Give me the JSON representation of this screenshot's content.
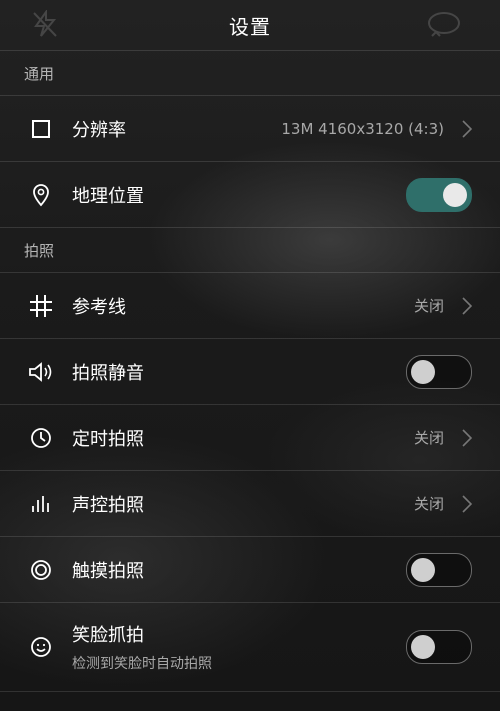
{
  "header": {
    "title": "设置"
  },
  "sections": {
    "general": "通用",
    "photo": "拍照"
  },
  "rows": {
    "resolution": {
      "label": "分辨率",
      "value": "13M 4160x3120 (4:3)",
      "icon": "square-icon"
    },
    "location": {
      "label": "地理位置",
      "toggle": true,
      "icon": "location-pin-icon"
    },
    "gridline": {
      "label": "参考线",
      "value": "关闭",
      "icon": "grid-icon"
    },
    "mute": {
      "label": "拍照静音",
      "toggle": false,
      "icon": "speaker-icon"
    },
    "timer": {
      "label": "定时拍照",
      "value": "关闭",
      "icon": "clock-icon"
    },
    "voice": {
      "label": "声控拍照",
      "value": "关闭",
      "icon": "equalizer-icon"
    },
    "touch": {
      "label": "触摸拍照",
      "toggle": false,
      "icon": "target-icon"
    },
    "smile": {
      "label": "笑脸抓拍",
      "sub": "检测到笑脸时自动拍照",
      "toggle": false,
      "icon": "smile-icon"
    }
  },
  "colors": {
    "accent": "#2f6f6a",
    "background": "#1a1a1a"
  }
}
